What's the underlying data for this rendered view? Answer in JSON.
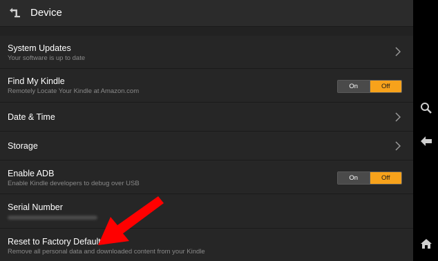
{
  "header": {
    "title": "Device",
    "back_icon": "back-arrow-icon"
  },
  "rows": [
    {
      "label": "System Updates",
      "subtitle": "Your software is up to date",
      "control": "chevron"
    },
    {
      "label": "Find My Kindle",
      "subtitle": "Remotely Locate Your Kindle at Amazon.com",
      "control": "toggle",
      "on_label": "On",
      "off_label": "Off",
      "selected": "Off"
    },
    {
      "label": "Date & Time",
      "control": "chevron"
    },
    {
      "label": "Storage",
      "control": "chevron"
    },
    {
      "label": "Enable ADB",
      "subtitle": "Enable Kindle developers to debug over USB",
      "control": "toggle",
      "on_label": "On",
      "off_label": "Off",
      "selected": "Off"
    },
    {
      "label": "Serial Number"
    },
    {
      "label": "Reset to Factory Defaults",
      "subtitle": "Remove all personal data and downloaded content from your Kindle"
    }
  ],
  "sidebar": {
    "icons": [
      "search-icon",
      "back-icon",
      "home-icon"
    ]
  },
  "colors": {
    "accent": "#f7a21b",
    "annotation_arrow": "#ff0000",
    "background": "#262626"
  }
}
